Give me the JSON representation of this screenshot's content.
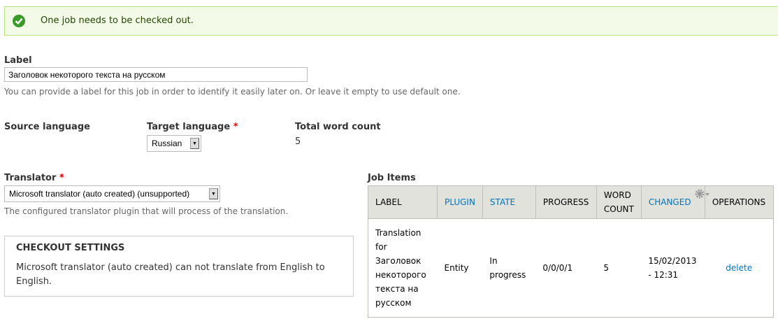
{
  "status_message": {
    "text": "One job needs to be checked out.",
    "icon": "check-circle-icon"
  },
  "label_field": {
    "label": "Label",
    "value": "Заголовок некоторого текста на русском",
    "description": "You can provide a label for this job in order to identify it easily later on. Or leave it empty to use default one."
  },
  "source_language": {
    "label": "Source language"
  },
  "target_language": {
    "label": "Target language",
    "required_mark": "*",
    "value": "Russian"
  },
  "total_word_count": {
    "label": "Total word count",
    "value": "5"
  },
  "translator": {
    "label": "Translator",
    "required_mark": "*",
    "value": "Microsoft translator (auto created) (unsupported)",
    "description": "The configured translator plugin that will process of the translation."
  },
  "checkout_settings": {
    "title": "CHECKOUT SETTINGS",
    "text": "Microsoft translator (auto created) can not translate from English to English."
  },
  "job_items": {
    "title": "Job Items",
    "columns": [
      "LABEL",
      "PLUGIN",
      "STATE",
      "PROGRESS",
      "WORD COUNT",
      "CHANGED",
      "OPERATIONS"
    ],
    "rows": [
      {
        "label": "Translation for Заголовок некоторого текста на русском",
        "plugin": "Entity",
        "state": "In progress",
        "progress": "0/0/0/1",
        "word_count": "5",
        "changed": "15/02/2013 - 12:31",
        "operation": "delete"
      }
    ]
  }
}
